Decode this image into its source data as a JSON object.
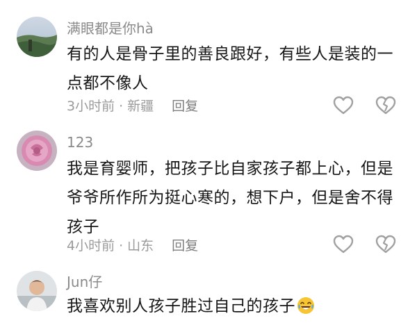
{
  "comments": [
    {
      "username": "满眼都是你hà",
      "text": "有的人是骨子里的善良跟好，有些人是装的一点都不像人",
      "time": "3小时前",
      "location": "新疆",
      "reply_label": "回复",
      "avatar": "landscape-avatar"
    },
    {
      "username": "123",
      "text": "我是育婴师，把孩子比自家孩子都上心，但是爷爷所作所为挺心寒的，想下户，但是舍不得孩子",
      "time": "4小时前",
      "location": "山东",
      "reply_label": "回复",
      "avatar": "rose-avatar"
    },
    {
      "username": "Jun仔",
      "text": "我喜欢别人孩子胜过自己的孩子",
      "emoji": "crying-laughing-emoji",
      "avatar": "child-avatar"
    }
  ],
  "separator": "·",
  "colors": {
    "text": "#161616",
    "muted": "#9a9a9a",
    "icon": "#a0a0a0"
  }
}
